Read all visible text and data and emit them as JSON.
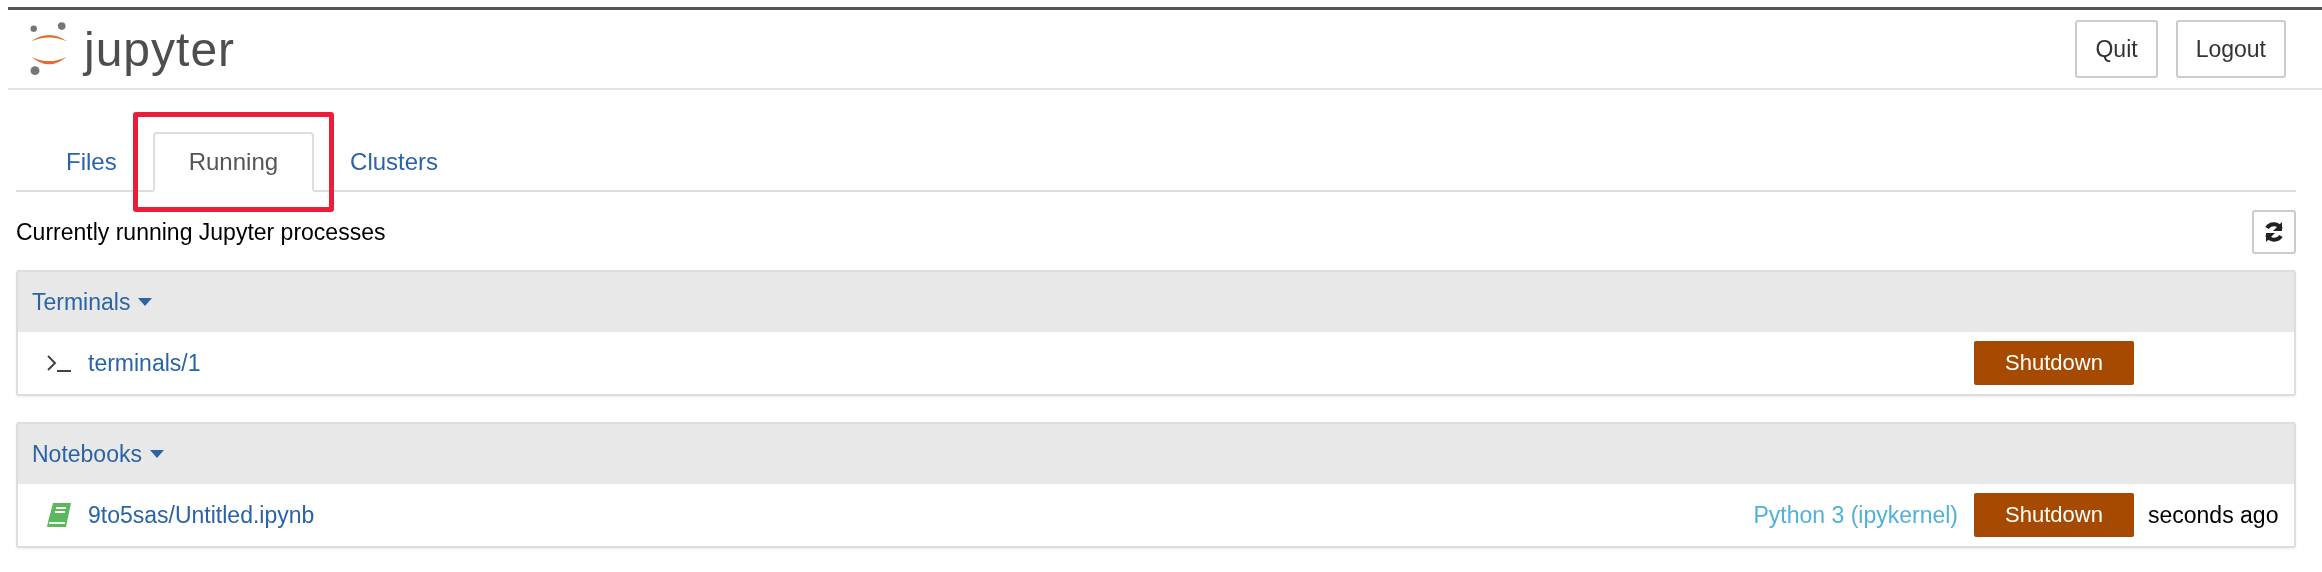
{
  "header": {
    "logo_text": "jupyter",
    "buttons": [
      "Quit",
      "Logout"
    ]
  },
  "tabs": [
    {
      "label": "Files",
      "selected": false,
      "highlighted": false
    },
    {
      "label": "Running",
      "selected": true,
      "highlighted": true
    },
    {
      "label": "Clusters",
      "selected": false,
      "highlighted": false
    }
  ],
  "intro": "Currently running Jupyter processes",
  "panels": [
    {
      "title": "Terminals",
      "expanded": true,
      "items": [
        {
          "kind": "terminal",
          "name": "terminals/1",
          "button": "Shutdown"
        }
      ]
    },
    {
      "title": "Notebooks",
      "expanded": true,
      "items": [
        {
          "kind": "notebook",
          "name": "9to5sas/Untitled.ipynb",
          "kernel": "Python 3 (ipykernel)",
          "button": "Shutdown",
          "time": "seconds ago"
        }
      ]
    }
  ]
}
